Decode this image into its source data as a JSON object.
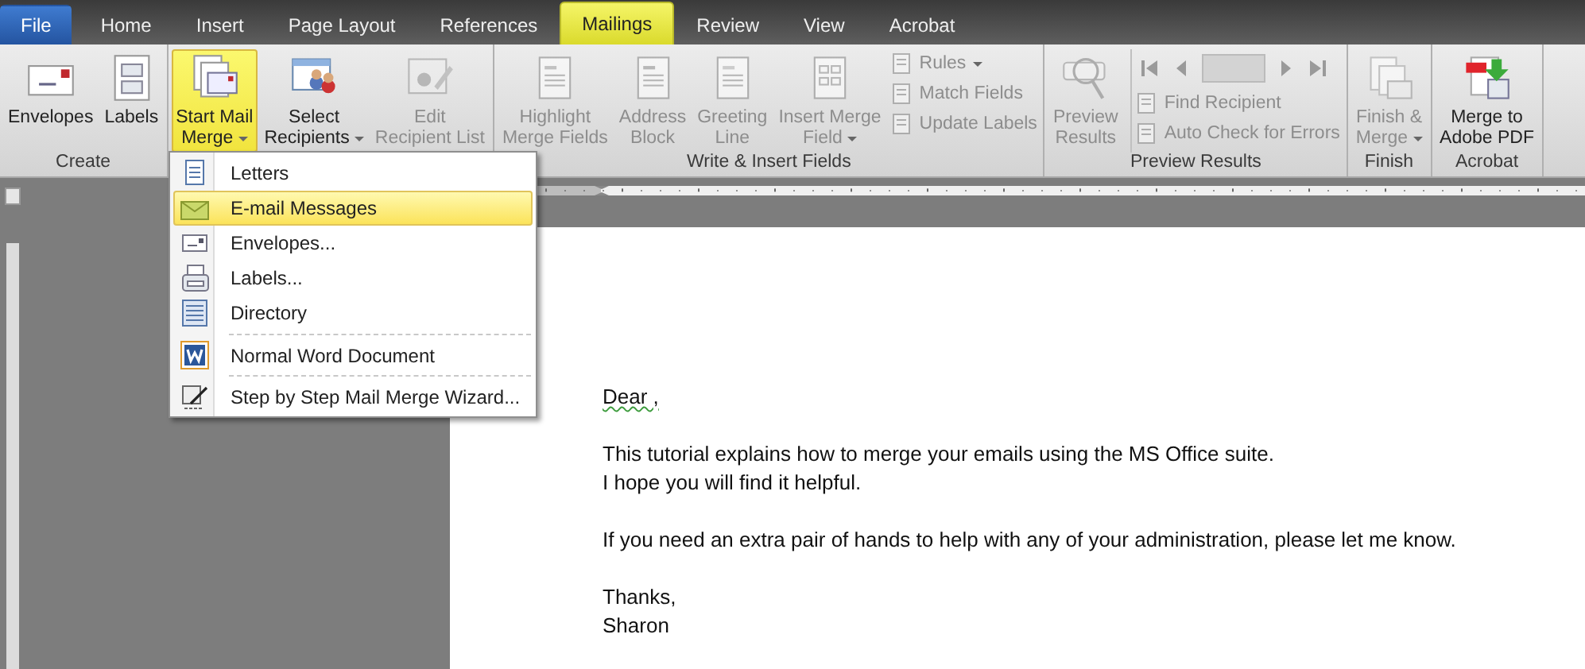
{
  "tabs": [
    {
      "label": "File",
      "kind": "file",
      "selected": false
    },
    {
      "label": "Home",
      "kind": "tab",
      "selected": false
    },
    {
      "label": "Insert",
      "kind": "tab",
      "selected": false
    },
    {
      "label": "Page Layout",
      "kind": "tab",
      "selected": false
    },
    {
      "label": "References",
      "kind": "tab",
      "selected": false
    },
    {
      "label": "Mailings",
      "kind": "tab",
      "selected": true
    },
    {
      "label": "Review",
      "kind": "tab",
      "selected": false
    },
    {
      "label": "View",
      "kind": "tab",
      "selected": false
    },
    {
      "label": "Acrobat",
      "kind": "tab",
      "selected": false
    }
  ],
  "ribbon": {
    "groups": [
      {
        "label": "Create",
        "controls": [
          {
            "kind": "large",
            "lines": [
              "Envelopes"
            ],
            "disabled": false,
            "selected": false,
            "dropdown": false
          },
          {
            "kind": "large",
            "lines": [
              "Labels"
            ],
            "disabled": false,
            "selected": false,
            "dropdown": false
          }
        ]
      },
      {
        "controls": [
          {
            "kind": "large",
            "lines": [
              "Start Mail",
              "Merge"
            ],
            "disabled": false,
            "selected": true,
            "dropdown": true
          },
          {
            "kind": "large",
            "lines": [
              "Select",
              "Recipients"
            ],
            "disabled": false,
            "selected": false,
            "dropdown": true
          },
          {
            "kind": "large",
            "lines": [
              "Edit",
              "Recipient List"
            ],
            "disabled": true,
            "selected": false,
            "dropdown": false
          }
        ]
      },
      {
        "label": "Write & Insert Fields",
        "controls": [
          {
            "kind": "large",
            "lines": [
              "Highlight",
              "Merge Fields"
            ],
            "disabled": true,
            "selected": false,
            "dropdown": false
          },
          {
            "kind": "large",
            "lines": [
              "Address",
              "Block"
            ],
            "disabled": true,
            "selected": false,
            "dropdown": false
          },
          {
            "kind": "large",
            "lines": [
              "Greeting",
              "Line"
            ],
            "disabled": true,
            "selected": false,
            "dropdown": false
          },
          {
            "kind": "large",
            "lines": [
              "Insert Merge",
              "Field"
            ],
            "disabled": true,
            "selected": false,
            "dropdown": true
          },
          {
            "kind": "stack",
            "items": [
              {
                "label": "Rules",
                "disabled": true,
                "dropdown": true
              },
              {
                "label": "Match Fields",
                "disabled": true,
                "dropdown": false
              },
              {
                "label": "Update Labels",
                "disabled": true,
                "dropdown": false
              }
            ]
          }
        ]
      },
      {
        "label": "Preview Results",
        "controls": [
          {
            "kind": "large",
            "lines": [
              "Preview",
              "Results"
            ],
            "disabled": true,
            "selected": false,
            "dropdown": false
          },
          {
            "kind": "nav",
            "disabled": true,
            "items": [
              {
                "label": "Find Recipient",
                "disabled": true,
                "dropdown": false
              },
              {
                "label": "Auto Check for Errors",
                "disabled": true,
                "dropdown": false
              }
            ]
          }
        ]
      },
      {
        "label": "Finish",
        "controls": [
          {
            "kind": "large",
            "lines": [
              "Finish &",
              "Merge"
            ],
            "disabled": true,
            "selected": false,
            "dropdown": true
          }
        ]
      },
      {
        "label": "Acrobat",
        "controls": [
          {
            "kind": "large",
            "lines": [
              "Merge to",
              "Adobe PDF"
            ],
            "disabled": false,
            "selected": false,
            "dropdown": false
          }
        ]
      }
    ]
  },
  "menu": {
    "items": [
      {
        "label": "Letters",
        "selected": false,
        "separator_before": false
      },
      {
        "label": "E-mail Messages",
        "selected": true,
        "separator_before": false
      },
      {
        "label": "Envelopes...",
        "selected": false,
        "separator_before": false
      },
      {
        "label": "Labels...",
        "selected": false,
        "separator_before": false
      },
      {
        "label": "Directory",
        "selected": false,
        "separator_before": false
      },
      {
        "label": "Normal Word Document",
        "selected": false,
        "separator_before": true
      },
      {
        "label": "Step by Step Mail Merge Wizard...",
        "selected": false,
        "separator_before": true
      }
    ]
  },
  "document": {
    "paragraphs": [
      {
        "lines": [
          "Dear ,"
        ],
        "grammar_flag": true
      },
      {
        "lines": [
          "This tutorial explains how to merge your emails using the MS Office suite.",
          "I hope you will find it helpful."
        ],
        "grammar_flag": false
      },
      {
        "lines": [
          "If you need an extra pair of hands to help with any of your administration, please let me know."
        ],
        "grammar_flag": false
      },
      {
        "lines": [
          "Thanks,",
          "Sharon"
        ],
        "grammar_flag": false
      }
    ]
  }
}
